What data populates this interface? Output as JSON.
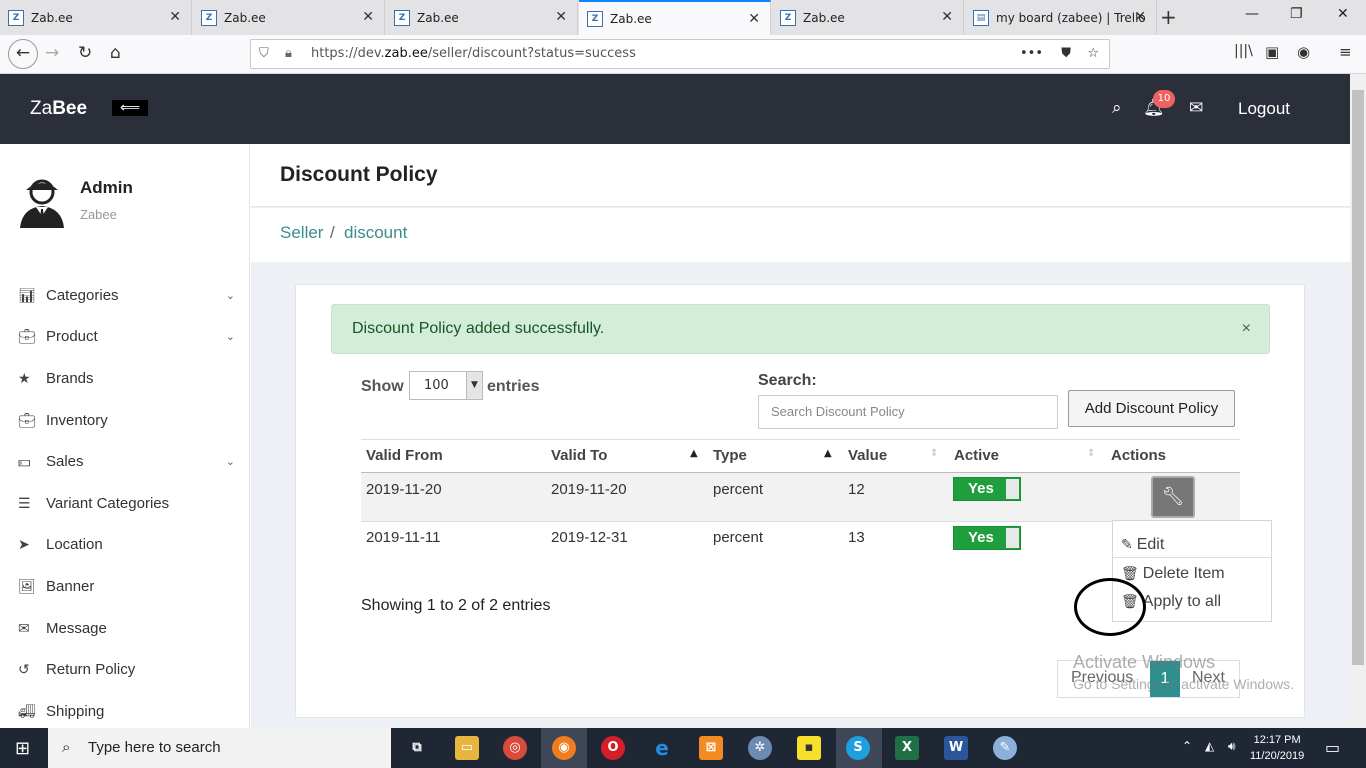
{
  "browser": {
    "tabs": [
      {
        "title": "Zab.ee"
      },
      {
        "title": "Zab.ee"
      },
      {
        "title": "Zab.ee"
      },
      {
        "title": "Zab.ee"
      },
      {
        "title": "Zab.ee"
      },
      {
        "title": "my board (zabee) | Trello"
      }
    ],
    "url_prefix": "https://dev.",
    "url_domain": "zab.ee",
    "url_path": "/seller/discount?status=success"
  },
  "topnav": {
    "logo_light": "Za",
    "logo_bold": "Bee",
    "notif_count": "10",
    "logout_label": "Logout"
  },
  "sidebar": {
    "user_name": "Admin",
    "user_sub": "Zabee",
    "items": [
      {
        "label": "Categories"
      },
      {
        "label": "Product"
      },
      {
        "label": "Brands"
      },
      {
        "label": "Inventory"
      },
      {
        "label": "Sales"
      },
      {
        "label": "Variant Categories"
      },
      {
        "label": "Location"
      },
      {
        "label": "Banner"
      },
      {
        "label": "Message"
      },
      {
        "label": "Return Policy"
      },
      {
        "label": "Shipping"
      }
    ]
  },
  "page": {
    "title": "Discount Policy",
    "breadcrumb_1": "Seller",
    "breadcrumb_sep": "/",
    "breadcrumb_2": "discount"
  },
  "alert": {
    "message": "Discount Policy added successfully.",
    "close": "×"
  },
  "table_controls": {
    "show_label": "Show",
    "entries_value": "100",
    "entries_label": "entries",
    "search_label": "Search:",
    "search_placeholder": "Search Discount Policy",
    "add_button": "Add Discount Policy"
  },
  "table": {
    "headers": [
      "Valid From",
      "Valid To",
      "Type",
      "Value",
      "Active",
      "Actions"
    ],
    "rows": [
      {
        "valid_from": "2019-11-20",
        "valid_to": "2019-11-20",
        "type": "percent",
        "value": "12",
        "active": "Yes"
      },
      {
        "valid_from": "2019-11-11",
        "valid_to": "2019-12-31",
        "type": "percent",
        "value": "13",
        "active": "Yes"
      }
    ],
    "showing": "Showing 1 to 2 of 2 entries"
  },
  "actions_menu": {
    "edit": "Edit",
    "delete": "Delete Item",
    "apply": "Apply to all"
  },
  "pagination": {
    "prev": "Previous",
    "current": "1",
    "next": "Next"
  },
  "watermark": {
    "line1": "Activate Windows",
    "line2": "Go to Settings to activate Windows."
  },
  "taskbar": {
    "search_placeholder": "Type here to search",
    "time": "12:17 PM",
    "date": "11/20/2019"
  }
}
